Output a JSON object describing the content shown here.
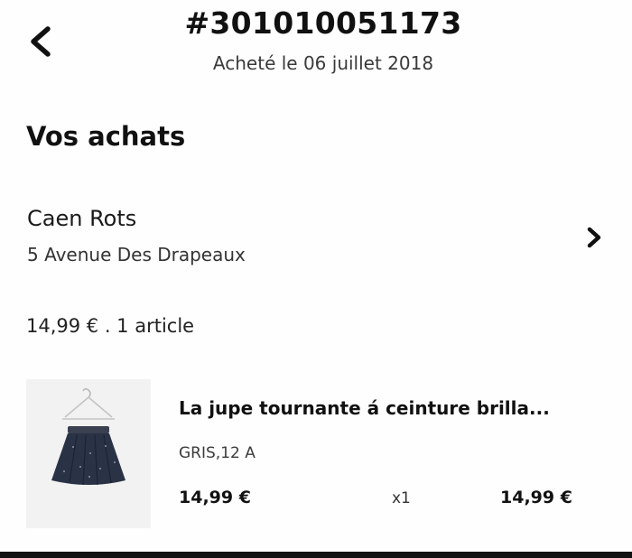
{
  "header": {
    "back_icon": "chevron-left-icon",
    "order_number": "#301010051173",
    "purchase_date": "Acheté le 06 juillet 2018"
  },
  "purchases": {
    "section_title": "Vos achats",
    "store": {
      "name": "Caen Rots",
      "address": "5 Avenue Des Drapeaux",
      "chevron_icon": "chevron-right-icon"
    },
    "summary": "14,99 € . 1 article",
    "items": [
      {
        "image_icon": "skirt-image",
        "title": "La jupe tournante á ceinture brilla...",
        "variant": "GRIS,12 A",
        "unit_price": "14,99 €",
        "quantity": "x1",
        "total_price": "14,99 €"
      }
    ]
  },
  "colors": {
    "text_primary": "#111111",
    "text_secondary": "#3a3a3a",
    "background": "#ffffff",
    "image_background": "#f2f2f2",
    "skirt_navy": "#272f44"
  }
}
